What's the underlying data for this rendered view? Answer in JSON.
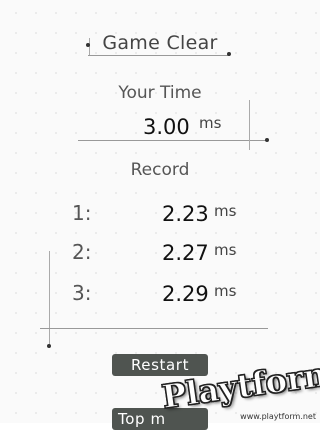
{
  "screen": {
    "title": "Game Clear",
    "your_time_label": "Your Time",
    "your_time_value": "3.00",
    "time_unit": "ms",
    "record_label": "Record",
    "records": [
      {
        "rank": "1:",
        "value": "2.23",
        "unit": "ms"
      },
      {
        "rank": "2:",
        "value": "2.27",
        "unit": "ms"
      },
      {
        "rank": "3:",
        "value": "2.29",
        "unit": "ms"
      }
    ],
    "restart_label": "Restart",
    "top_label": "Top m"
  },
  "watermark": {
    "logo_text": "Playtform",
    "url": "www.playtform.net"
  },
  "colors": {
    "button_bg": "#4f5450",
    "text_dark": "#111111",
    "background": "#f3f3f3"
  }
}
